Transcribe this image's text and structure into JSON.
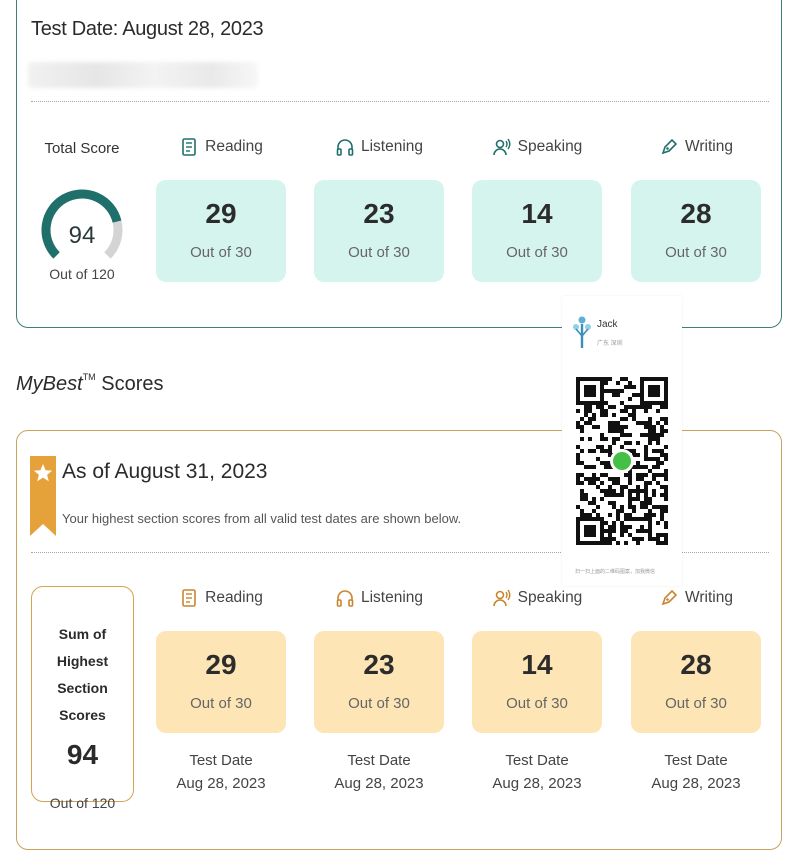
{
  "header": {
    "test_date": "Test Date: August 28, 2023"
  },
  "total": {
    "label": "Total Score",
    "value": "94",
    "out_of": "Out of 120",
    "fraction": 0.783
  },
  "sections": [
    {
      "name": "Reading",
      "score": "29",
      "out_of": "Out of 30",
      "icon": "book-icon"
    },
    {
      "name": "Listening",
      "score": "23",
      "out_of": "Out of 30",
      "icon": "headphones-icon"
    },
    {
      "name": "Speaking",
      "score": "14",
      "out_of": "Out of 30",
      "icon": "speaker-icon"
    },
    {
      "name": "Writing",
      "score": "28",
      "out_of": "Out of 30",
      "icon": "pen-icon"
    }
  ],
  "mybest": {
    "title_italic": "MyBest",
    "tm": "TM",
    "title_rest": " Scores",
    "as_of": "As of August 31, 2023",
    "subtitle": "Your highest section scores from all valid test dates are shown below.",
    "sum_label_line1": "Sum of Highest",
    "sum_label_line2": "Section Scores",
    "sum_value": "94",
    "sum_out_of": "Out of 120",
    "sections": [
      {
        "name": "Reading",
        "score": "29",
        "out_of": "Out of 30",
        "date_label": "Test Date",
        "date": "Aug 28, 2023"
      },
      {
        "name": "Listening",
        "score": "23",
        "out_of": "Out of 30",
        "date_label": "Test Date",
        "date": "Aug 28, 2023"
      },
      {
        "name": "Speaking",
        "score": "14",
        "out_of": "Out of 30",
        "date_label": "Test Date",
        "date": "Aug 28, 2023"
      },
      {
        "name": "Writing",
        "score": "28",
        "out_of": "Out of 30",
        "date_label": "Test Date",
        "date": "Aug 28, 2023"
      }
    ]
  },
  "qr": {
    "name": "Jack",
    "sub": "广东 深圳",
    "footer": "扫一扫上面的二维码图案，加我微信"
  },
  "colors": {
    "teal": "#1f6f6a",
    "teal_tile": "#d6f4ee",
    "gold_tile": "#fde5b5",
    "gold_border": "#c9a25c",
    "badge": "#e5a23a"
  }
}
